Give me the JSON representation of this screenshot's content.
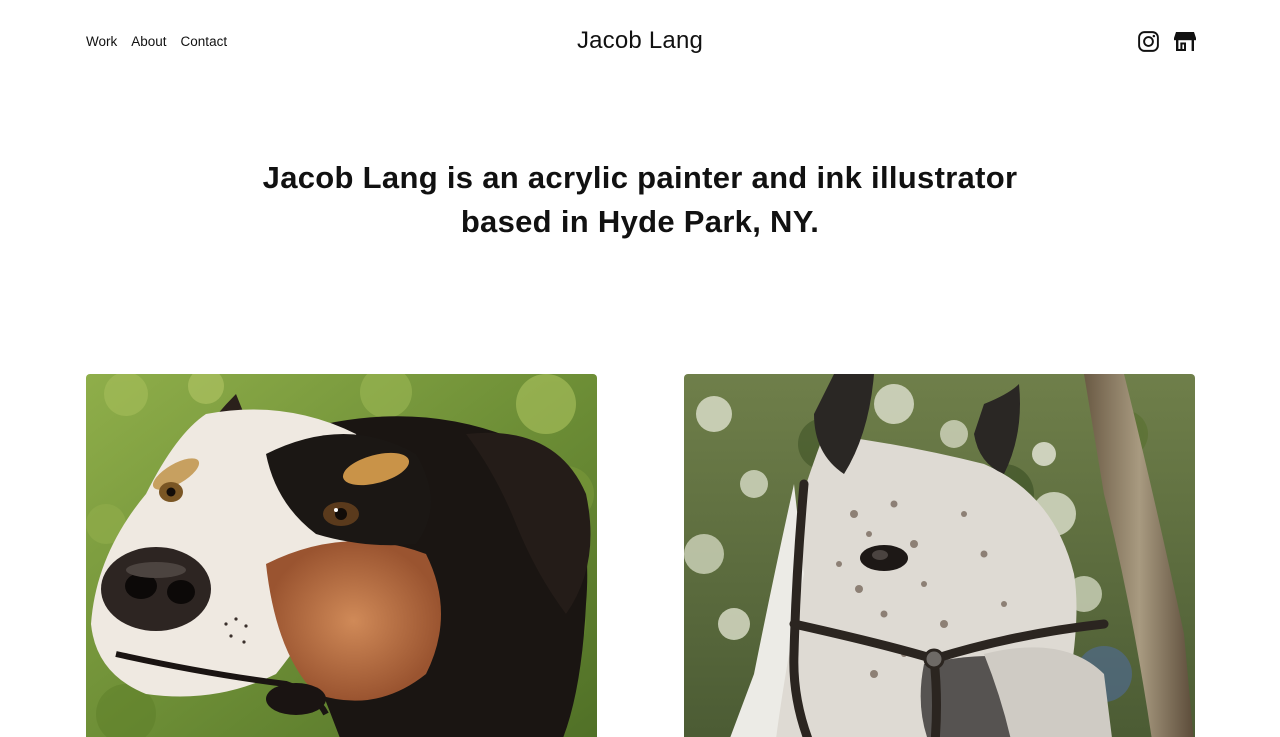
{
  "nav": {
    "items": [
      {
        "label": "Work"
      },
      {
        "label": "About"
      },
      {
        "label": "Contact"
      }
    ]
  },
  "site": {
    "title": "Jacob Lang"
  },
  "social": {
    "instagram_icon": "instagram-icon",
    "shop_icon": "storefront-icon"
  },
  "intro": {
    "line1": "Jacob Lang is an acrylic painter and ink illustrator",
    "line2": "based in Hyde Park, NY."
  },
  "gallery": {
    "items": [
      {
        "subject": "dog-painting",
        "alt": "Painting of a tricolor dog"
      },
      {
        "subject": "horse-painting",
        "alt": "Painting of a dappled horse with halter"
      }
    ]
  },
  "colors": {
    "text": "#111111",
    "background": "#ffffff"
  }
}
